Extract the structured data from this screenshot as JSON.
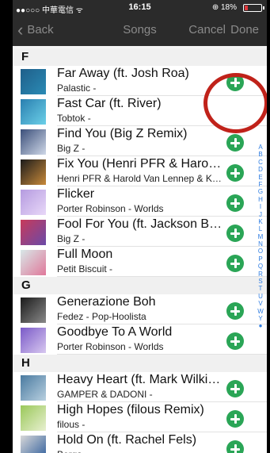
{
  "status": {
    "carrier": "●●○○○ 中華電信 ᯤ",
    "time": "16:15",
    "battery_text": "⊕ 18%",
    "battery_level": 0.18
  },
  "nav": {
    "back_label": "Back",
    "title": "Songs",
    "cancel_label": "Cancel",
    "done_label": "Done"
  },
  "sections": [
    {
      "letter": "F",
      "songs": [
        {
          "title": "Far Away (ft. Josh Roa)",
          "subtitle": "Palastic -",
          "art": [
            "#1f5f8a",
            "#2b8bb5"
          ],
          "added": false
        },
        {
          "title": "Fast Car (ft. River)",
          "subtitle": "Tobtok -",
          "art": [
            "#2a7fb0",
            "#6bd0e8"
          ],
          "added": true
        },
        {
          "title": "Find You (Big Z Remix)",
          "subtitle": "Big Z -",
          "art": [
            "#3b4f7a",
            "#cfd8e8"
          ],
          "added": false
        },
        {
          "title": "Fix You (Henri PFR & Harold Van Lennep & Kid Felix Remix)",
          "subtitle": "Henri PFR & Harold Van Lennep & Kid Felix -",
          "art": [
            "#1b1b1b",
            "#c88a3a"
          ],
          "added": false
        },
        {
          "title": "Flicker",
          "subtitle": "Porter Robinson - Worlds",
          "art": [
            "#b59be0",
            "#e8d8f8"
          ],
          "added": false
        },
        {
          "title": "Fool For You (ft. Jackson Breit)",
          "subtitle": "Big Z -",
          "art": [
            "#c83a5a",
            "#6a4aa8"
          ],
          "added": false
        },
        {
          "title": "Full Moon",
          "subtitle": "Petit Biscuit -",
          "art": [
            "#d8e8e8",
            "#e0789a"
          ],
          "added": false
        }
      ]
    },
    {
      "letter": "G",
      "songs": [
        {
          "title": "Generazione Boh",
          "subtitle": "Fedez - Pop-Hoolista",
          "art": [
            "#1a1a1a",
            "#8a8a8a"
          ],
          "added": false
        },
        {
          "title": "Goodbye To A World",
          "subtitle": "Porter Robinson - Worlds",
          "art": [
            "#7a5ac8",
            "#d8c8f0"
          ],
          "added": false
        }
      ]
    },
    {
      "letter": "H",
      "songs": [
        {
          "title": "Heavy Heart (ft. Mark Wilkinson)",
          "subtitle": "GAMPER & DADONI -",
          "art": [
            "#4a7aa0",
            "#b8d0e0"
          ],
          "added": false
        },
        {
          "title": "High Hopes (filous Remix)",
          "subtitle": "filous -",
          "art": [
            "#9ac85a",
            "#e8f0d0"
          ],
          "added": false
        },
        {
          "title": "Hold On (ft. Rachel Fels)",
          "subtitle": "Bergs -",
          "art": [
            "#d8d8d8",
            "#2a5a9a"
          ],
          "added": false
        }
      ]
    }
  ],
  "index_letters": [
    "A",
    "B",
    "C",
    "D",
    "E",
    "F",
    "G",
    "H",
    "I",
    "J",
    "K",
    "L",
    "M",
    "N",
    "O",
    "P",
    "Q",
    "R",
    "S",
    "T",
    "U",
    "V",
    "W",
    "Y",
    "●"
  ],
  "colors": {
    "accent_add": "#2aa556",
    "index": "#2f7de1",
    "highlight_circle": "#c0221a",
    "nav_bar": "#2b2b2b"
  }
}
